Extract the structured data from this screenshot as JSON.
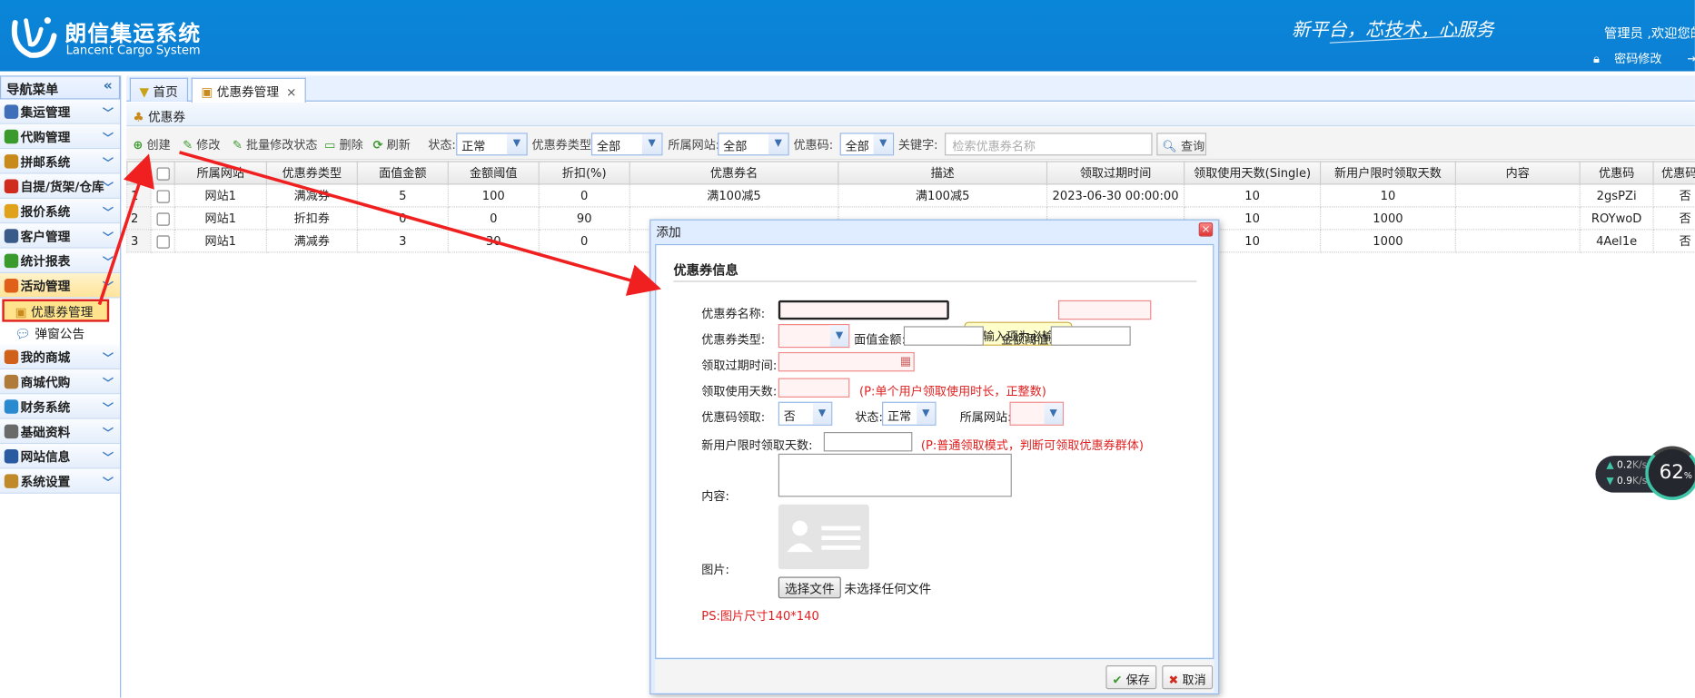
{
  "header": {
    "title": "朗信集运系统",
    "subtitle": "Lancent Cargo System",
    "slogan": "新平台，芯技术，心服务",
    "welcome": "管理员 ,欢迎您的",
    "change_password": "密码修改",
    "logout": "安"
  },
  "sidebar": {
    "title": "导航菜单",
    "collapse": "«",
    "items": [
      {
        "label": "集运管理",
        "icon": "ship-icon",
        "color": "#3f6fb8"
      },
      {
        "label": "代购管理",
        "icon": "globe-icon",
        "color": "#3a9a2c"
      },
      {
        "label": "拼邮系统",
        "icon": "box-icon",
        "color": "#c98a1c"
      },
      {
        "label": "自提/货架/仓库",
        "icon": "warehouse-icon",
        "color": "#d02b1f"
      },
      {
        "label": "报价系统",
        "icon": "coins-icon",
        "color": "#e0a21a"
      },
      {
        "label": "客户管理",
        "icon": "user-icon",
        "color": "#3a5a8a"
      },
      {
        "label": "统计报表",
        "icon": "chart-icon",
        "color": "#3a9a2c"
      },
      {
        "label": "活动管理",
        "icon": "rainbow-icon",
        "color": "#e0601a"
      },
      {
        "label": "我的商城",
        "icon": "basketball-icon",
        "color": "#d0601a"
      },
      {
        "label": "商城代购",
        "icon": "shop-icon",
        "color": "#b07a3a"
      },
      {
        "label": "财务系统",
        "icon": "pie-icon",
        "color": "#2a8ad0"
      },
      {
        "label": "基础资料",
        "icon": "database-icon",
        "color": "#6a6a6a"
      },
      {
        "label": "网站信息",
        "icon": "font-icon",
        "color": "#2a5aa0"
      },
      {
        "label": "系统设置",
        "icon": "wrench-icon",
        "color": "#c08a2a"
      }
    ],
    "sub_items": [
      {
        "label": "优惠券管理",
        "icon": "coupon-icon"
      },
      {
        "label": "弹窗公告",
        "icon": "chat-icon"
      }
    ]
  },
  "tabs": [
    {
      "label": "首页",
      "icon": "home-icon"
    },
    {
      "label": "优惠券管理",
      "icon": "coupon-icon",
      "close": "×"
    }
  ],
  "panel_title": "优惠券",
  "toolbar": {
    "create": "创建",
    "edit": "修改",
    "batch_status": "批量修改状态",
    "delete": "删除",
    "refresh": "刷新",
    "status_label": "状态:",
    "status_value": "正常",
    "type_label": "优惠券类型:",
    "type_value": "全部",
    "site_label": "所属网站:",
    "site_value": "全部",
    "code_label": "优惠码:",
    "code_value": "全部",
    "keyword_label": "关键字:",
    "keyword_placeholder": "检索优惠券名称",
    "query": "查询"
  },
  "table": {
    "columns": [
      "所属网站",
      "优惠券类型",
      "面值金额",
      "金额阈值",
      "折扣(%)",
      "优惠券名",
      "描述",
      "领取过期时间",
      "领取使用天数(Single)",
      "新用户限时领取天数",
      "内容",
      "优惠码",
      "优惠码领"
    ],
    "rows": [
      {
        "num": "1",
        "cells": [
          "网站1",
          "满减券",
          "5",
          "100",
          "0",
          "满100减5",
          "满100减5",
          "2023-06-30 00:00:00",
          "10",
          "10",
          "",
          "2gsPZi",
          "否"
        ]
      },
      {
        "num": "2",
        "cells": [
          "网站1",
          "折扣券",
          "0",
          "0",
          "90",
          "",
          "",
          "",
          "10",
          "1000",
          "",
          "ROYwoD",
          "否"
        ]
      },
      {
        "num": "3",
        "cells": [
          "网站1",
          "满减券",
          "3",
          "30",
          "0",
          "",
          "",
          "",
          "10",
          "1000",
          "",
          "4Ael1e",
          "否"
        ]
      }
    ]
  },
  "network": {
    "up": "0.2",
    "down": "0.9",
    "unit": "K/s",
    "percent": "62",
    "percent_unit": "%"
  },
  "dialog": {
    "title": "添加",
    "close": "×",
    "section": "优惠券信息",
    "name_label": "优惠券名称:",
    "name_tip": "该输入项为必输项",
    "type_label": "优惠券类型:",
    "face_label": "面值金额:",
    "threshold_label": "金额阈值:",
    "expire_label": "领取过期时间:",
    "days_label": "领取使用天数:",
    "days_hint": "(P:单个用户领取使用时长，正整数)",
    "code_label": "优惠码领取:",
    "code_value": "否",
    "status_label": "状态:",
    "status_value": "正常",
    "site_label": "所属网站:",
    "newuser_label": "新用户限时领取天数:",
    "newuser_hint": "(P:普通领取模式，判断可领取优惠券群体)",
    "content_label": "内容:",
    "image_label": "图片:",
    "file_button": "选择文件",
    "file_text": "未选择任何文件",
    "size_note": "PS:图片尺寸140*140",
    "save": "保存",
    "cancel": "取消"
  },
  "colors": {
    "header_blue": "#0a86d8",
    "highlight_red": "#e02020",
    "error_pink": "#fff3f3"
  }
}
